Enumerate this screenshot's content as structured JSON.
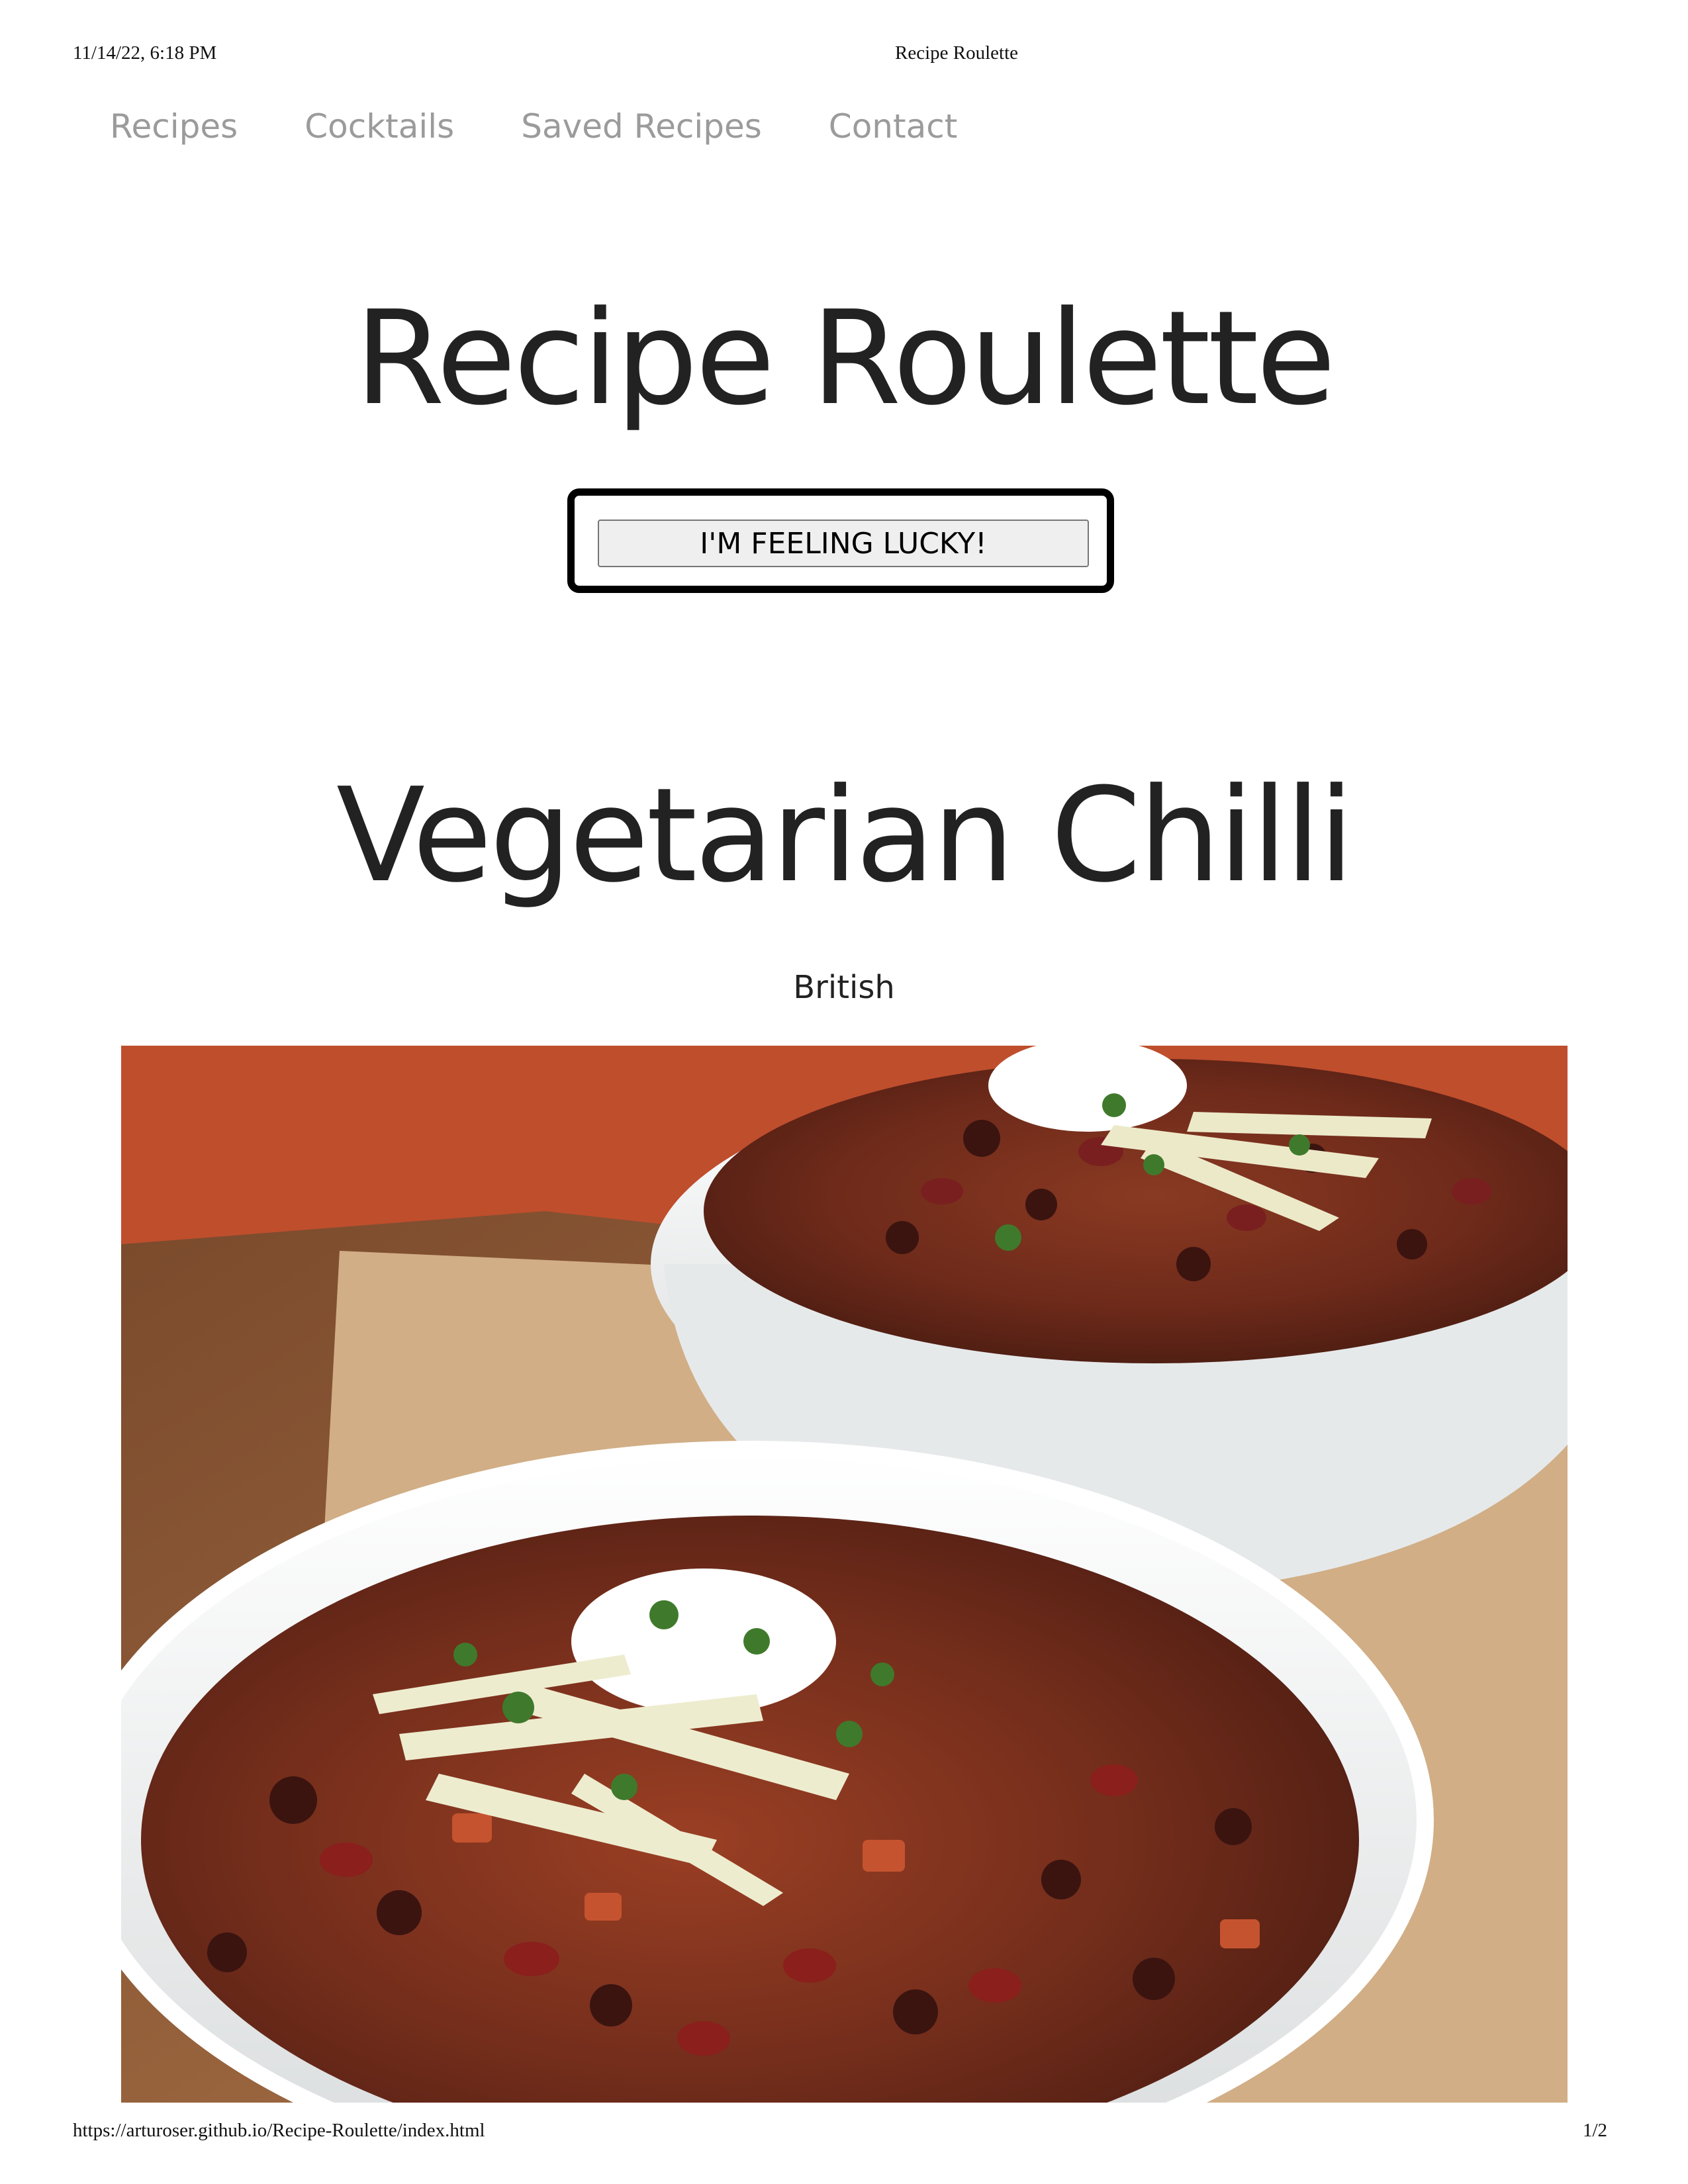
{
  "print_header": {
    "datetime": "11/14/22, 6:18 PM",
    "page_title": "Recipe Roulette"
  },
  "nav": {
    "items": [
      {
        "label": "Recipes"
      },
      {
        "label": "Cocktails"
      },
      {
        "label": "Saved Recipes"
      },
      {
        "label": "Contact"
      }
    ],
    "link_color": "#9b9b9b"
  },
  "hero": {
    "title": "Recipe Roulette",
    "lucky_button_label": "I'M FEELING LUCKY!"
  },
  "recipe": {
    "title": "Vegetarian Chilli",
    "cuisine": "British",
    "image_subject": "two white bowls of bean chilli topped with sour cream, shredded cheese and cilantro on a wooden board over an orange cloth"
  },
  "print_footer": {
    "url": "https://arturoser.github.io/Recipe-Roulette/index.html",
    "page_number": "1/2"
  }
}
